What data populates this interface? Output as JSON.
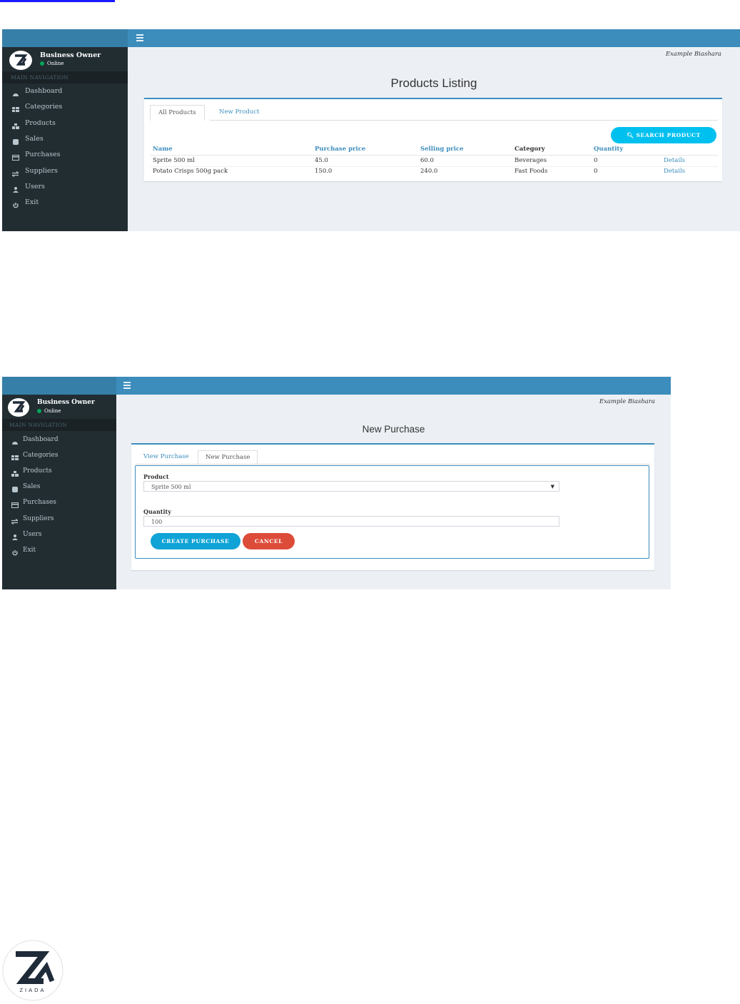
{
  "colors": {
    "topbar": "#3c8dbc",
    "logo_area": "#367fa9",
    "sidebar": "#222d32",
    "content_bg": "#ecf0f5",
    "accent_link": "#3c8dbc",
    "search_button": "#00c0ef",
    "create_button": "#0fa3d6",
    "cancel_button": "#dd4b39",
    "online_dot": "#00a65a"
  },
  "screen1": {
    "user": {
      "name": "Business Owner",
      "status": "Online"
    },
    "nav_header": "MAIN NAVIGATION",
    "nav_items": [
      {
        "label": "Dashboard",
        "icon": "dashboard-icon"
      },
      {
        "label": "Categories",
        "icon": "th-icon"
      },
      {
        "label": "Products",
        "icon": "cubes-icon"
      },
      {
        "label": "Sales",
        "icon": "database-icon"
      },
      {
        "label": "Purchases",
        "icon": "credit-card-icon"
      },
      {
        "label": "Suppliers",
        "icon": "exchange-icon"
      },
      {
        "label": "Users",
        "icon": "user-icon"
      },
      {
        "label": "Exit",
        "icon": "power-icon"
      }
    ],
    "brand": "Example Biashara",
    "page_title": "Products Listing",
    "tabs": [
      "All Products",
      "New Product"
    ],
    "search_button": "SEARCH PRODUCT",
    "table": {
      "headers": [
        "Name",
        "Purchase price",
        "Selling price",
        "Category",
        "Quantity"
      ],
      "rows": [
        {
          "name": "Sprite 500 ml",
          "purchase_price": "45.0",
          "selling_price": "60.0",
          "category": "Beverages",
          "quantity": "0",
          "action": "Details"
        },
        {
          "name": "Potato Crisps 500g pack",
          "purchase_price": "150.0",
          "selling_price": "240.0",
          "category": "Fast Foods",
          "quantity": "0",
          "action": "Details"
        }
      ]
    }
  },
  "screen2": {
    "user": {
      "name": "Business Owner",
      "status": "Online"
    },
    "nav_header": "MAIN NAVIGATION",
    "nav_items": [
      {
        "label": "Dashboard",
        "icon": "dashboard-icon"
      },
      {
        "label": "Categories",
        "icon": "th-icon"
      },
      {
        "label": "Products",
        "icon": "cubes-icon"
      },
      {
        "label": "Sales",
        "icon": "database-icon"
      },
      {
        "label": "Purchases",
        "icon": "credit-card-icon"
      },
      {
        "label": "Suppliers",
        "icon": "exchange-icon"
      },
      {
        "label": "Users",
        "icon": "user-icon"
      },
      {
        "label": "Exit",
        "icon": "power-icon"
      }
    ],
    "brand": "Example Biashara",
    "page_title": "New Purchase",
    "tabs": [
      "View Purchase",
      "New Purchase"
    ],
    "form": {
      "product_label": "Product",
      "product_value": "Sprite 500 ml",
      "quantity_label": "Quantity",
      "quantity_value": "100",
      "create_button": "CREATE PURCHASE",
      "cancel_button": "CANCEL"
    }
  },
  "footer_logo": {
    "text": "ZIADA"
  }
}
